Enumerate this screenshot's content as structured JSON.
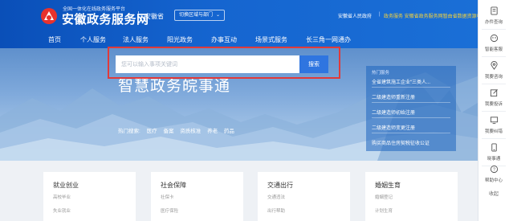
{
  "header": {
    "brand_sub": "全国一体化在线政务服务平台",
    "brand_main": "安徽政务服务网",
    "province": "安徽省",
    "switch_label": "切换区域与部门",
    "gov_link": "安徽省人民政府",
    "separator": "|",
    "notice": "政务服务 安徽省政务服务网暂由省数据资源中心"
  },
  "nav": {
    "items": [
      "首页",
      "个人服务",
      "法人服务",
      "阳光政务",
      "办事互动",
      "场景式服务",
      "长三角一网通办"
    ]
  },
  "hero": {
    "title": "智慧政务皖事通",
    "search_placeholder": "您可以输入事项关键词",
    "search_button": "搜索",
    "hot_label": "热门搜索:",
    "hot_terms": [
      "医疗",
      "备案",
      "资质核准",
      "养老",
      "药品"
    ]
  },
  "hot_panel": {
    "title": "热门服务",
    "items": [
      "全省建筑施工企业“三类人...",
      "二级建造师重新注册",
      "二级建造师初始注册",
      "二级建造师变更注册",
      "购买商品住房契税征收公证"
    ]
  },
  "cards": [
    {
      "title": "就业创业",
      "line1": "高校毕业",
      "line2": "失业就业"
    },
    {
      "title": "社会保障",
      "line1": "社保卡",
      "line2": "医疗保险"
    },
    {
      "title": "交通出行",
      "line1": "交通违法",
      "line2": "出行帮助"
    },
    {
      "title": "婚姻生育",
      "line1": "婚姻登记",
      "line2": "计划生育"
    }
  ],
  "sidebar": {
    "items": [
      {
        "label": "办件查询",
        "icon": "document-search-icon"
      },
      {
        "label": "智能客服",
        "icon": "robot-icon"
      },
      {
        "label": "我要咨询",
        "icon": "location-pin-icon"
      },
      {
        "label": "我要投诉",
        "icon": "edit-icon"
      },
      {
        "label": "我要纠错",
        "icon": "monitor-icon"
      },
      {
        "label": "晓事通",
        "icon": "phone-icon"
      },
      {
        "label": "帮助中心",
        "icon": "help-circle-icon"
      }
    ],
    "collapse": "收起"
  },
  "colors": {
    "header_blue": "#1565d0",
    "search_button": "#2f75e0",
    "highlight_border": "#e03a3a",
    "notice_yellow": "#f4d23c"
  }
}
